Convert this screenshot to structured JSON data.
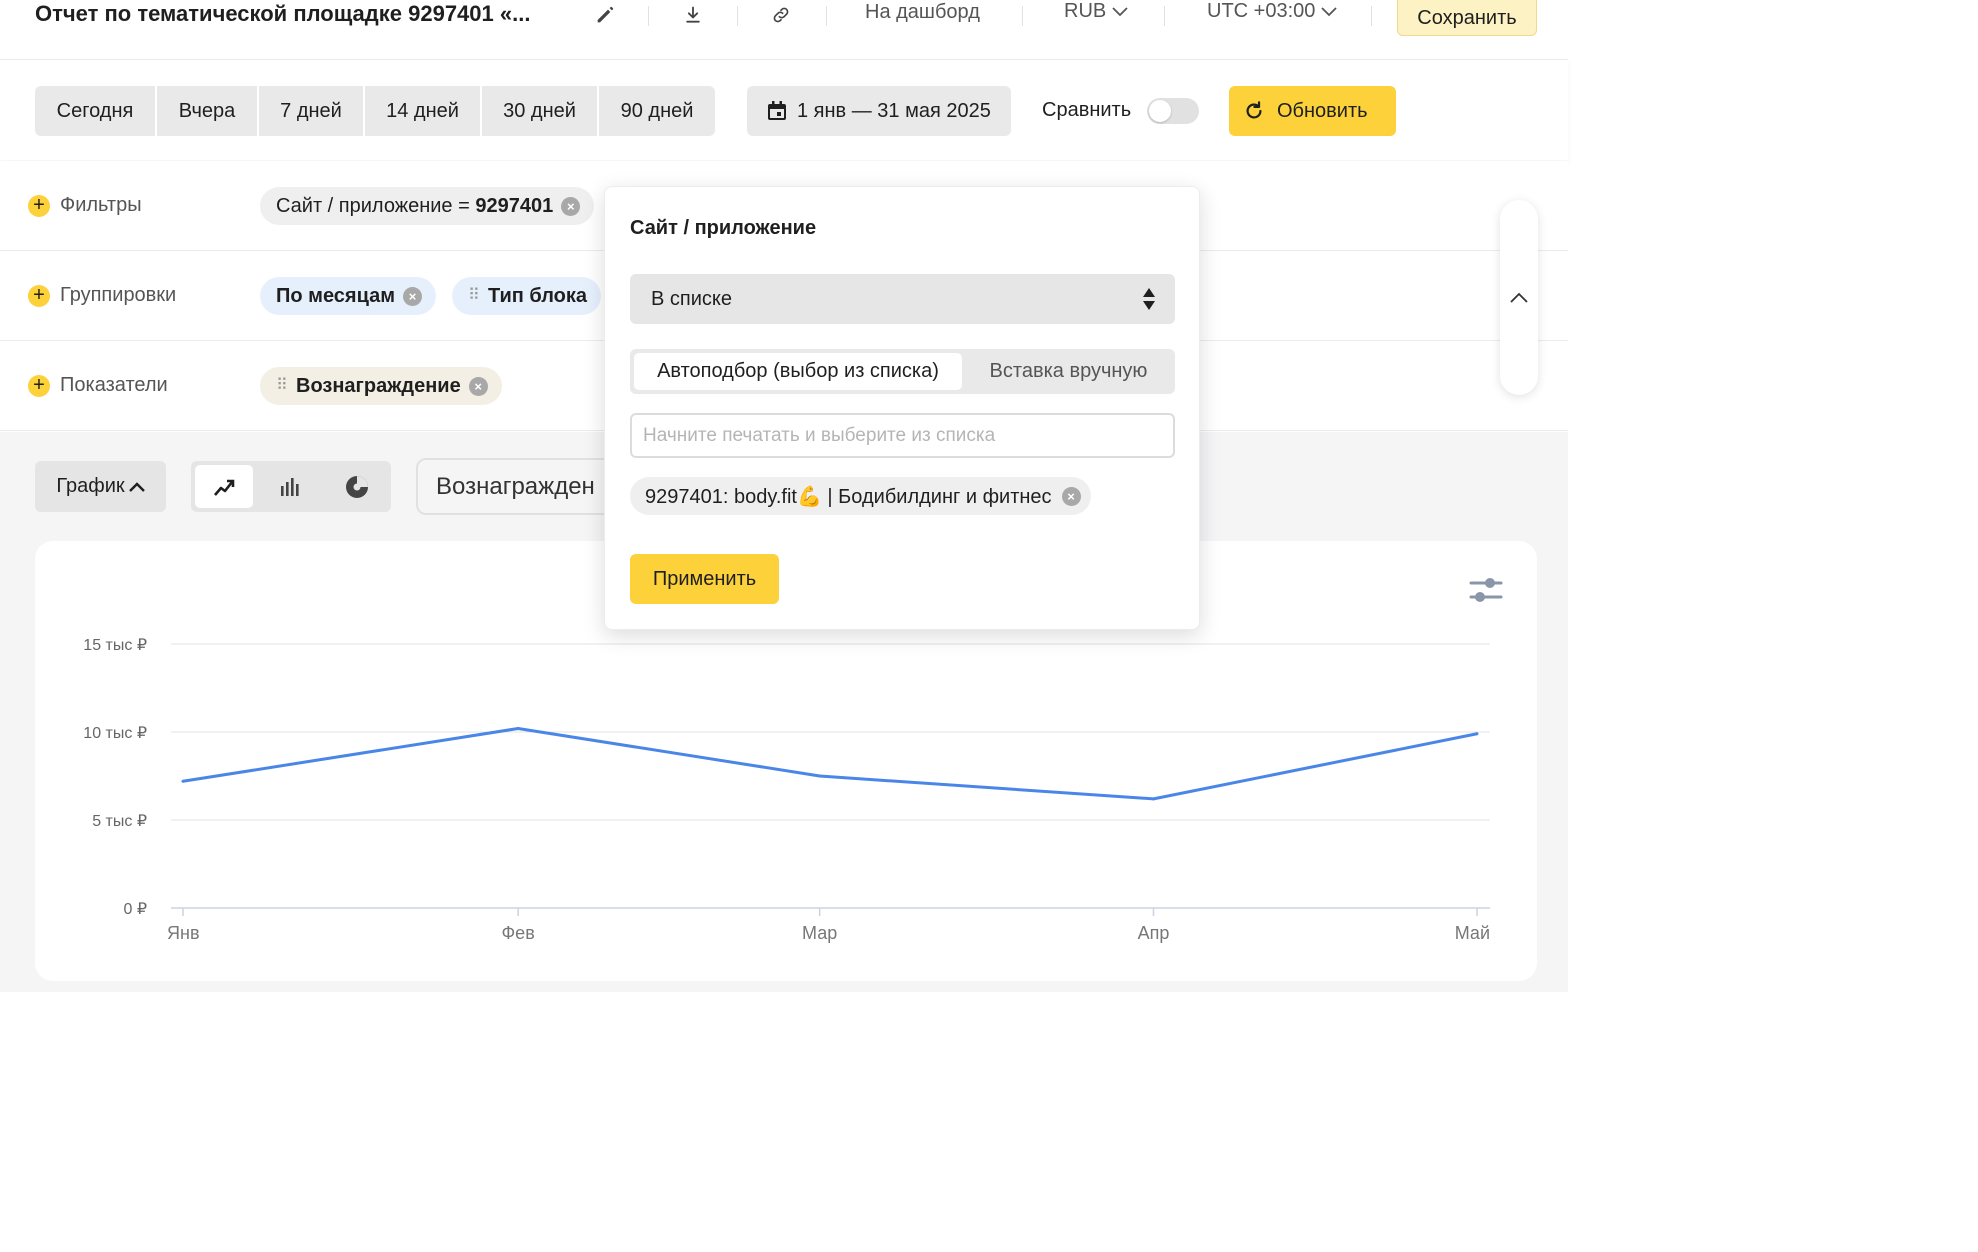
{
  "header": {
    "title": "Отчет по тематической площадке 9297401 «...",
    "to_dashboard": "На дашборд",
    "currency": "RUB",
    "timezone": "UTC +03:00",
    "save": "Сохранить",
    "icons": [
      "pencil-icon",
      "download-icon",
      "link-icon"
    ]
  },
  "period": {
    "presets": [
      "Сегодня",
      "Вчера",
      "7 дней",
      "14 дней",
      "30 дней",
      "90 дней"
    ],
    "date_range": "1 янв — 31 мая 2025",
    "compare_label": "Сравнить",
    "compare_enabled": false,
    "refresh": "Обновить"
  },
  "filters": {
    "label": "Фильтры",
    "chip": {
      "key": "Сайт / приложение = ",
      "value": "9297401"
    }
  },
  "groupings": {
    "label": "Группировки",
    "chips": [
      "По месяцам",
      "Тип блока"
    ]
  },
  "metrics": {
    "label": "Показатели",
    "chips": [
      "Вознаграждение"
    ]
  },
  "view": {
    "graph_label": "График",
    "chart_types": [
      "line-chart-icon",
      "bar-chart-icon",
      "pie-chart-icon"
    ],
    "active_chart_type": "line-chart-icon",
    "metric_select": "Вознагражден"
  },
  "popup": {
    "title": "Сайт / приложение",
    "operator": "В списке",
    "modes": [
      "Автоподбор (выбор из списка)",
      "Вставка вручную"
    ],
    "active_mode": "Автоподбор (выбор из списка)",
    "search_placeholder": "Начните печатать и выберите из списка",
    "selected": "9297401: body.fit💪 | Бодибилдинг и фитнес",
    "apply": "Применить"
  },
  "colors": {
    "accent_yellow": "#fcd13a",
    "series_blue": "#4a86e8",
    "grid": "#e3e3e3"
  },
  "chart_data": {
    "type": "line",
    "categories": [
      "Янв",
      "Фев",
      "Мар",
      "Апр",
      "Май"
    ],
    "series": [
      {
        "values": [
          7200,
          10200,
          7500,
          6200,
          9900
        ]
      }
    ],
    "y_ticks": [
      "0 ₽",
      "5 тыс ₽",
      "10 тыс ₽",
      "15 тыс ₽"
    ],
    "y_tick_values": [
      0,
      5000,
      10000,
      15000
    ],
    "ylim": [
      0,
      15000
    ],
    "grid": true,
    "legend": "none"
  }
}
